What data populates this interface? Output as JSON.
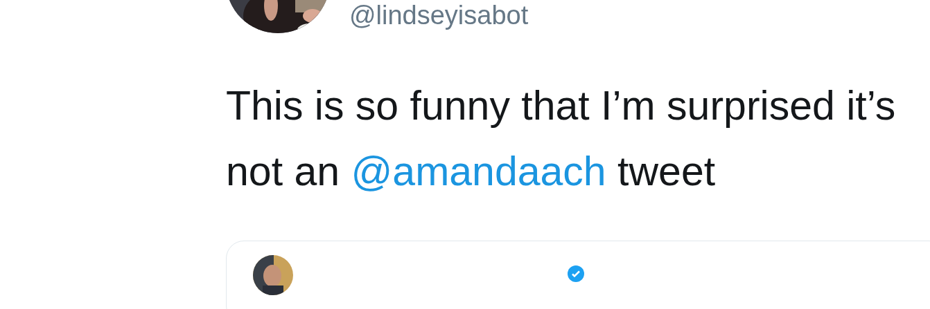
{
  "tweet": {
    "author_handle": "@lindseyisabot",
    "text": "This is so funny that I’m surprised it’s not an ",
    "mention": "@amandaach",
    "text_end": " tweet",
    "quoted_tweet": {
      "author_verified": true
    }
  }
}
